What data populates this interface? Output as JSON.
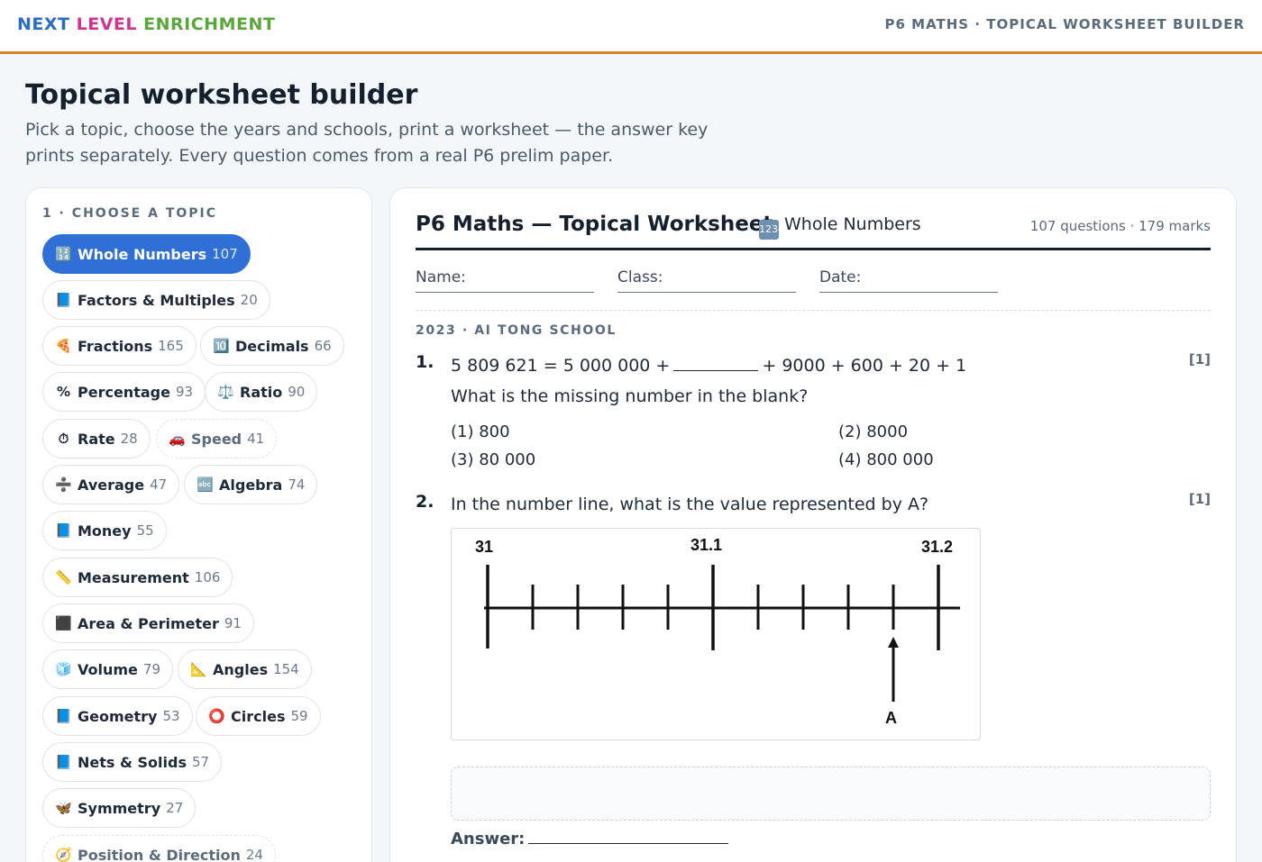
{
  "header": {
    "brand": [
      "NEXT",
      "LEVEL",
      "ENRICHMENT"
    ],
    "breadcrumb": "P6 MATHS · TOPICAL WORKSHEET BUILDER"
  },
  "intro": {
    "title": "Topical worksheet builder",
    "subtitle": "Pick a topic, choose the years and schools, print a worksheet — the answer key prints separately. Every question comes from a real P6 prelim paper."
  },
  "topics": {
    "step_label": "1 · CHOOSE A TOPIC",
    "items": [
      {
        "icon": "🔢",
        "label": "Whole Numbers",
        "count": "107",
        "active": true
      },
      {
        "icon": "📘",
        "label": "Factors & Multiples",
        "count": "20"
      },
      {
        "icon": "🍕",
        "label": "Fractions",
        "count": "165"
      },
      {
        "icon": "🔟",
        "label": "Decimals",
        "count": "66"
      },
      {
        "icon": "%",
        "label": "Percentage",
        "count": "93"
      },
      {
        "icon": "⚖️",
        "label": "Ratio",
        "count": "90"
      },
      {
        "icon": "⏱",
        "label": "Rate",
        "count": "28"
      },
      {
        "icon": "🚗",
        "label": "Speed",
        "count": "41"
      },
      {
        "icon": "➗",
        "label": "Average",
        "count": "47"
      },
      {
        "icon": "🔤",
        "label": "Algebra",
        "count": "74"
      },
      {
        "icon": "📘",
        "label": "Money",
        "count": "55"
      },
      {
        "icon": "📏",
        "label": "Measurement",
        "count": "106"
      },
      {
        "icon": "⬛",
        "label": "Area & Perimeter",
        "count": "91"
      },
      {
        "icon": "🧊",
        "label": "Volume",
        "count": "79"
      },
      {
        "icon": "📐",
        "label": "Angles",
        "count": "154"
      },
      {
        "icon": "📘",
        "label": "Geometry",
        "count": "53"
      },
      {
        "icon": "⭕",
        "label": "Circles",
        "count": "59"
      },
      {
        "icon": "📘",
        "label": "Nets & Solids",
        "count": "57"
      },
      {
        "icon": "🦋",
        "label": "Symmetry",
        "count": "27"
      },
      {
        "icon": "🧭",
        "label": "Position & Direction",
        "count": "24"
      }
    ]
  },
  "worksheet": {
    "title": "P6 Maths — Topical Worksheet",
    "topic_icon": "1234",
    "topic": "Whole Numbers",
    "meta": "107 questions · 179 marks",
    "fields": {
      "name": "Name:",
      "class": "Class:",
      "date": "Date:"
    },
    "source": "2023 · AI TONG SCHOOL",
    "q1": {
      "num": "1.",
      "line_a": "5 809 621 = 5 000 000 +",
      "line_b": "+ 9000 + 600 + 20 + 1",
      "prompt": "What is the missing number in the blank?",
      "marks": "[1]",
      "options": [
        "(1) 800",
        "(2) 8000",
        "(3) 80 000",
        "(4) 800 000"
      ]
    },
    "q2": {
      "num": "2.",
      "text": "In the number line, what is the value represented by A?",
      "marks": "[1]",
      "figure_labels": {
        "left": "31",
        "mid": "31.1",
        "right": "31.2",
        "pointer": "A"
      }
    },
    "answer_label": "Answer:"
  }
}
